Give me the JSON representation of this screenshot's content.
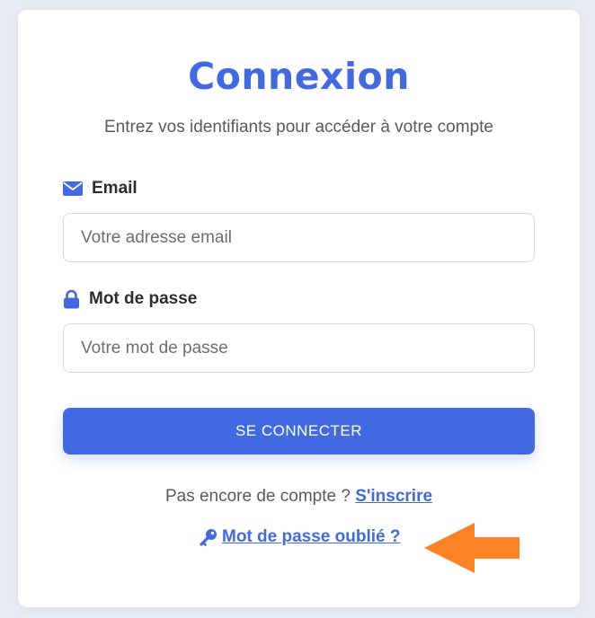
{
  "login": {
    "title": "Connexion",
    "subtitle": "Entrez vos identifiants pour accéder à votre compte",
    "email": {
      "label": "Email",
      "icon": "envelope-icon",
      "placeholder": "Votre adresse email",
      "value": ""
    },
    "password": {
      "label": "Mot de passe",
      "icon": "lock-icon",
      "placeholder": "Votre mot de passe",
      "value": ""
    },
    "submit_label": "SE CONNECTER",
    "signup_prompt": "Pas encore de compte ? ",
    "signup_link": "S'inscrire",
    "forgot_link": "Mot de passe oublié ?",
    "forgot_icon": "key-icon"
  },
  "colors": {
    "accent": "#4169e1",
    "annotation_arrow": "#fd8426"
  }
}
